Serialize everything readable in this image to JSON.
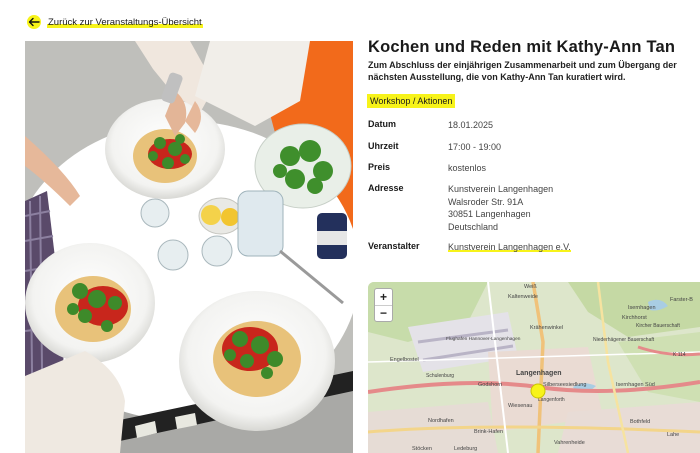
{
  "back_link": {
    "label": "Zurück zur Veranstaltungs-Übersicht"
  },
  "event": {
    "title": "Kochen und Reden mit Kathy-Ann Tan",
    "subtitle": "Zum Abschluss der einjährigen Zusammenarbeit und zum Übergang der nächsten Ausstellung, die von Kathy-Ann Tan kuratiert wird.",
    "category": "Workshop / Aktionen"
  },
  "details": {
    "date_label": "Datum",
    "date_value": "18.01.2025",
    "time_label": "Uhrzeit",
    "time_value": "17:00 - 19:00",
    "price_label": "Preis",
    "price_value": "kostenlos",
    "address_label": "Adresse",
    "address_lines": [
      "Kunstverein Langenhagen",
      "Walsroder Str. 91A",
      "30851 Langenhagen",
      "Deutschland"
    ],
    "organizer_label": "Veranstalter",
    "organizer_value": "Kunstverein Langenhagen e.V."
  },
  "map": {
    "zoom_in": "+",
    "zoom_out": "−",
    "labels": {
      "weit": "Weiß",
      "kaltenweide": "Kaltenweide",
      "isernhagen": "Isernhagen",
      "farster": "Farster-B",
      "kirchhorst": "Kirchhorst",
      "kirchner": "Kircher Bauerschaft",
      "kraehenwinkel": "Krähenwinkel",
      "flughafen": "Flughafen Hannover-Langenhagen",
      "niederhaegener": "Niederhägener Bauerschaft",
      "engelbostel": "Engelbostel",
      "schulenburg": "Schulenburg",
      "k114": "K 114",
      "langenhagen": "Langenhagen",
      "godshorn": "Godshorn",
      "silbersee": "Silberseesiedlung",
      "isernhagen_sued": "Isernhagen Süd",
      "langenforth": "Langenforth",
      "wiesenau": "Wiesenau",
      "nordhafen": "Nordhafen",
      "bothfeld": "Bothfeld",
      "brink_hafen": "Brink-Hafen",
      "stoecken": "Stöcken",
      "ledeburg": "Ledeburg",
      "vahrenheide": "Vahrenheide",
      "lahe": "Lahe"
    },
    "marker_color": "#f7f31a"
  },
  "colors": {
    "accent": "#f7f31a",
    "orange": "#f26a1b"
  }
}
